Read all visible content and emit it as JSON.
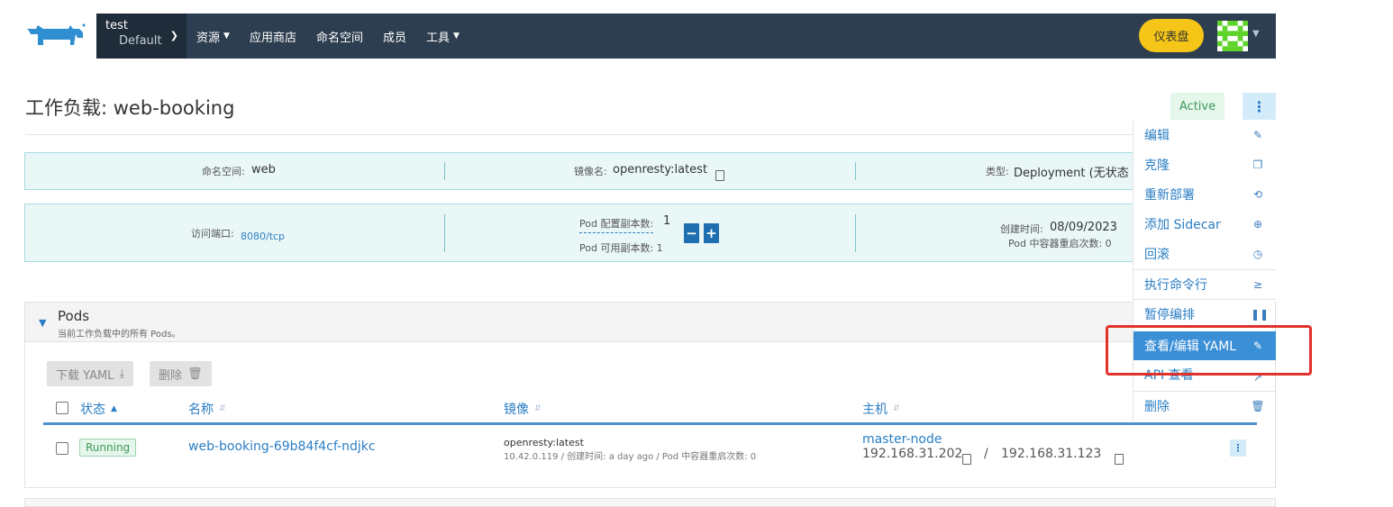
{
  "header": {
    "cluster": {
      "name": "test",
      "project": "Default"
    },
    "nav": [
      {
        "label": "资源",
        "has_dropdown": true
      },
      {
        "label": "应用商店",
        "has_dropdown": false
      },
      {
        "label": "命名空间",
        "has_dropdown": false
      },
      {
        "label": "成员",
        "has_dropdown": false
      },
      {
        "label": "工具",
        "has_dropdown": true
      }
    ],
    "dashboard_button": "仪表盘",
    "brand_color": "#2d3e50",
    "accent_color": "#f5c518"
  },
  "page": {
    "title": "工作负载: web-booking",
    "status": "Active"
  },
  "info": {
    "namespace_label": "命名空间:",
    "namespace_value": "web",
    "image_label": "镜像名:",
    "image_value": "openresty:latest",
    "type_label": "类型:",
    "type_value": "Deployment (无状态",
    "port_label": "访问端口:",
    "port_value": "8080/tcp",
    "replicas_label": "Pod 配置副本数:",
    "replicas_value": "1",
    "available_label": "Pod 可用副本数: 1",
    "created_label": "创建时间:",
    "created_value": "08/09/2023",
    "restarts_label": "Pod 中容器重启次数: 0",
    "minus": "−",
    "plus": "+"
  },
  "menu": {
    "items": [
      {
        "label": "编辑",
        "icon": "pencil-icon"
      },
      {
        "label": "克隆",
        "icon": "copy-icon"
      },
      {
        "label": "重新部署",
        "icon": "redeploy-icon"
      },
      {
        "label": "添加 Sidecar",
        "icon": "plus-circle-icon"
      },
      {
        "label": "回滚",
        "icon": "history-icon"
      },
      {
        "label": "执行命令行",
        "icon": "terminal-icon"
      },
      {
        "label": "暂停编排",
        "icon": "pause-icon"
      },
      {
        "label": "查看/编辑 YAML",
        "icon": "pencil-icon",
        "highlighted": true
      },
      {
        "label": "API 查看",
        "icon": "external-link-icon"
      },
      {
        "label": "删除",
        "icon": "trash-icon"
      }
    ]
  },
  "pods": {
    "title": "Pods",
    "subtitle": "当前工作负载中的所有 Pods。",
    "toolbar": {
      "download": "下载 YAML",
      "delete": "删除"
    },
    "columns": [
      "状态",
      "名称",
      "镜像",
      "主机"
    ],
    "rows": [
      {
        "status": "Running",
        "name": "web-booking-69b84f4cf-ndjkc",
        "image": "openresty:latest",
        "image_detail": "10.42.0.119 / 创建时间: a day ago / Pod 中容器重启次数: 0",
        "host": "master-node",
        "ip1": "192.168.31.202",
        "sep": "/",
        "ip2": "192.168.31.123"
      }
    ]
  }
}
